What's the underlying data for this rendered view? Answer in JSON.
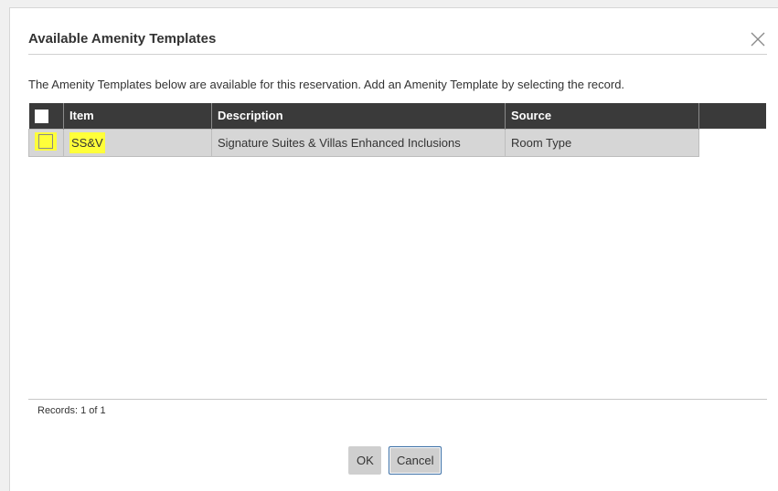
{
  "dialog": {
    "title": "Available Amenity Templates",
    "intro": "The Amenity Templates below are available for this reservation. Add an Amenity Template by selecting the record."
  },
  "table": {
    "columns": [
      "Item",
      "Description",
      "Source"
    ],
    "rows": [
      {
        "item": "SS&V",
        "description": "Signature Suites & Villas Enhanced Inclusions",
        "source": "Room Type",
        "checked": false
      }
    ]
  },
  "footer": {
    "records": "Records: 1 of 1",
    "ok_label": "OK",
    "cancel_label": "Cancel"
  },
  "colors": {
    "header_bg": "#3a3a3a",
    "row_bg": "#d6d6d6",
    "highlight": "#ffff3a",
    "focus_border": "#3a6ea5"
  },
  "icons": {
    "close": "close-icon"
  }
}
